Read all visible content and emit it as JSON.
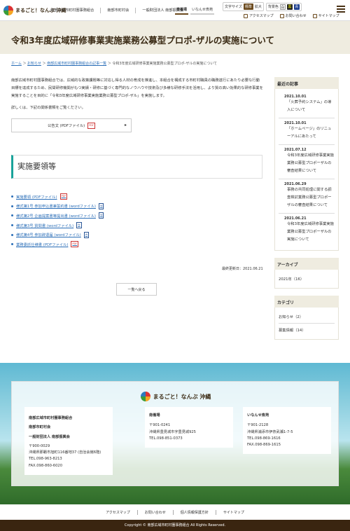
{
  "header": {
    "logo_text": "まるごと！なんぶ 沖縄",
    "nav": [
      "南部広域市町村圏事務組合",
      "南部市町村会",
      "一般財団法人 南部振興会"
    ],
    "tabs": [
      "南養場",
      "いなんせ斎苑"
    ],
    "text_size_label": "文字サイズ",
    "text_size_standard": "標準",
    "text_size_large": "拡大",
    "bg_color_label": "背景色",
    "bg_colors": [
      "白",
      "黒",
      "青"
    ],
    "util": [
      "アクセスマップ",
      "お問い合わせ",
      "サイトマップ"
    ]
  },
  "page": {
    "title": "令和3年度広域研修事業実施業務公募型プロポ-ザルの実施について",
    "breadcrumb": [
      "ホーム",
      "お知らせ",
      "南部広域市町村圏事務組合の記事一覧",
      "令和3年度広域研修事業実施業務公募型プロポ-ザルの実施について"
    ],
    "intro": "南部広域市町村圏事務組合では、広域的な政策課題等に対応し得る人材の育成を推進し、本組合を構成する市町村職員の職務遂行にあたり必要な行動目標を達成するため、民間研修機関がもつ実績・研修に基づく専門的なノウハウや技術及び多様な研修手法を活用し、より質の高い効果的な研修事業を実施することを目的に「令和3年度広域研修事業実施業務公募型プロポ-ザル」を実施します。",
    "intro2": "詳しくは、下記の関係書類をご覧ください。",
    "download_label": "公告文 (PDFファイル)",
    "section_title": "実施要領等",
    "links": [
      {
        "label": "実施要領 (PDFファイル)",
        "type": "pdf"
      },
      {
        "label": "様式第1号 参加申込書兼誓約書 (wordファイル)",
        "type": "word"
      },
      {
        "label": "様式第2号 企画提案書等提出書 (wordファイル)",
        "type": "word"
      },
      {
        "label": "様式第3号 質問書 (wordファイル)",
        "type": "word"
      },
      {
        "label": "様式第4号 参加辞退届 (wordファイル)",
        "type": "word"
      },
      {
        "label": "業務委託仕様書 (PDFファイル)",
        "type": "pdf"
      }
    ],
    "updated": "最終更新日：2021.06.21",
    "back_label": "一覧へ戻る"
  },
  "sidebar": {
    "recent_title": "最近の記事",
    "recent": [
      {
        "date": "2021.10.01",
        "title": "「火葬予約システム」の導入について"
      },
      {
        "date": "2021.10.01",
        "title": "「ホームページ」のリニューアルにあたって"
      },
      {
        "date": "2021.07.12",
        "title": "令和3年度広域研修事業実施業務公募型プロポーザルの審査結果について"
      },
      {
        "date": "2021.06.29",
        "title": "事務の共同処理に関する調査検討業務公募型プロポーザルの審査結果について"
      },
      {
        "date": "2021.06.21",
        "title": "令和3年度広域研修事業実施業務公募型プロポーザルの実施について"
      }
    ],
    "archive_title": "アーカイブ",
    "archive": [
      "2021年（16）"
    ],
    "category_title": "カテゴリ",
    "categories": [
      "お知らせ（2）",
      "募集情報（14）"
    ]
  },
  "footer": {
    "logo_text": "まるごと！なんぶ 沖縄",
    "col1": {
      "items": [
        "南部広域市町村圏事務組合",
        "南部市町村会",
        "一般財団法人 南部振興会"
      ],
      "zip": "〒900-0029",
      "address": "沖縄県那覇市旭町116番地37 (自治会館6階)",
      "tel": "TEL.098-963-8213",
      "fax": "FAX.098-860-6020"
    },
    "col2": {
      "title": "南養場",
      "zip": "〒901-0241",
      "address": "沖縄県豊見城市字豊見城925",
      "tel": "TEL.098-851-0373"
    },
    "col3": {
      "title": "いなんせ斎苑",
      "zip": "〒901-2128",
      "address": "沖縄県浦添市伊奈武瀬1-7-5",
      "tel": "TEL.098-869-1616",
      "fax": "FAX.098-869-1615"
    },
    "menu": [
      "アクセスマップ",
      "お問い合わせ",
      "個人情報保護方針",
      "サイトマップ"
    ],
    "copyright": "Copyright © 南部広域市町村圏事務組合 All Rights Reserved."
  }
}
